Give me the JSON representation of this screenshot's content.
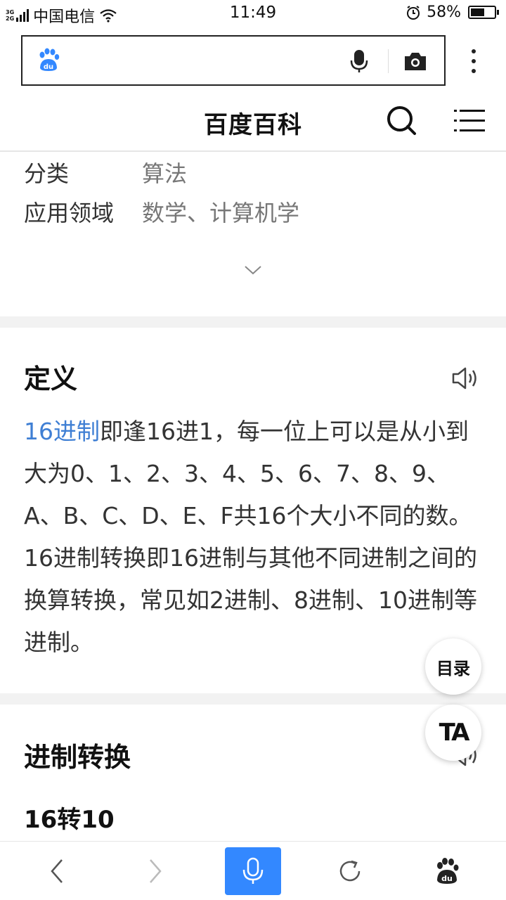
{
  "status_bar": {
    "network_top": "3G",
    "network_bottom": "2G",
    "carrier": "中国电信",
    "time": "11:49",
    "battery": "58%",
    "battery_level": 0.58
  },
  "header": {
    "brand": "百度百科"
  },
  "info": {
    "rows": [
      {
        "key": "分类",
        "value": "算法"
      },
      {
        "key": "应用领域",
        "value": "数学、计算机学"
      }
    ]
  },
  "definition": {
    "title": "定义",
    "link_text": "16进制",
    "body": "即逢16进1，每一位上可以是从小到大为0、1、2、3、4、5、6、7、8、9、A、B、C、D、E、F共16个大小不同的数。16进制转换即16进制与其他不同进制之间的换算转换，常见如2进制、8进制、10进制等进制。"
  },
  "conversion": {
    "title": "进制转换",
    "subhead": "16转10"
  },
  "floating": {
    "toc_label": "目录",
    "ta_label": "TA"
  },
  "icons": {
    "colors": {
      "accent": "#3388ff",
      "link": "#3f7fd4"
    }
  }
}
